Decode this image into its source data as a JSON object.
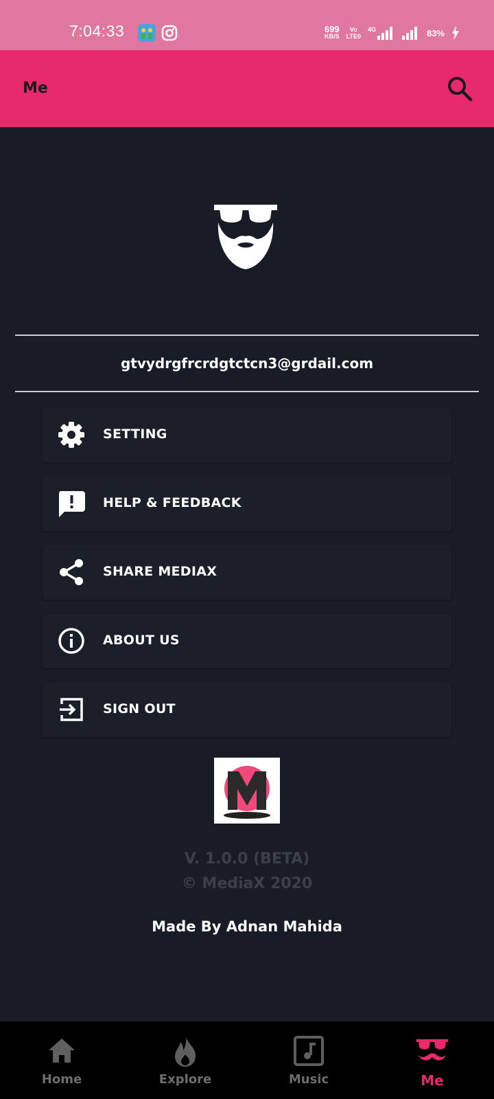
{
  "status_bar": {
    "time": "7:04:33",
    "net_speed_value": "699",
    "net_speed_unit": "KB/S",
    "volte_top": "Vo",
    "volte_bottom": "LTE0",
    "network": "4G",
    "battery": "83%"
  },
  "app_bar": {
    "title": "Me",
    "search_icon": "search-icon"
  },
  "profile": {
    "avatar_icon": "beard-sunglasses-avatar-icon",
    "email": "gtvydrgfrcrdgtctcn3@grdail.com"
  },
  "menu": [
    {
      "label": "SETTING",
      "icon": "gear-icon"
    },
    {
      "label": "HELP & FEEDBACK",
      "icon": "feedback-icon"
    },
    {
      "label": "SHARE MEDIAX",
      "icon": "share-icon"
    },
    {
      "label": "ABOUT US",
      "icon": "info-icon"
    },
    {
      "label": "SIGN OUT",
      "icon": "exit-icon"
    }
  ],
  "footer": {
    "version": "V. 1.0.0 (BETA)",
    "copyright": "© MediaX 2020",
    "made_by": "Made By Adnan Mahida"
  },
  "bottom_nav": [
    {
      "label": "Home",
      "icon": "home-icon",
      "active": false
    },
    {
      "label": "Explore",
      "icon": "flame-icon",
      "active": false
    },
    {
      "label": "Music",
      "icon": "music-icon",
      "active": false
    },
    {
      "label": "Me",
      "icon": "me-mustache-icon",
      "active": true
    }
  ],
  "colors": {
    "accent": "#e82a6d",
    "status_bar": "#df779e",
    "background": "#181c26",
    "nav_background": "#000000"
  }
}
